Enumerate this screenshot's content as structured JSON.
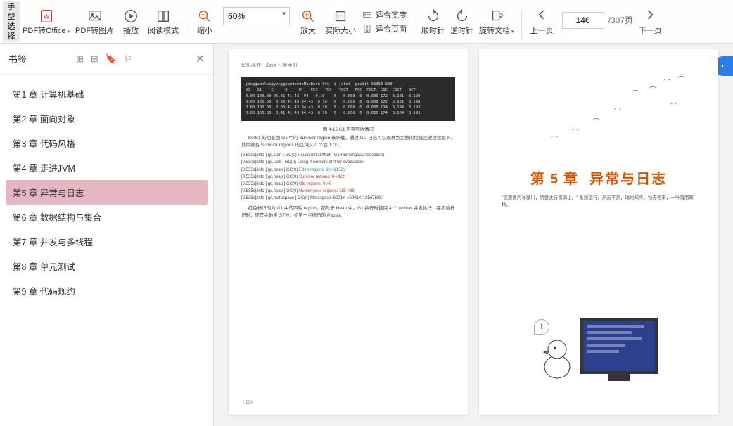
{
  "toolbar": {
    "handle_tab": "手型\n选择",
    "pdf_office": "PDF转Office",
    "pdf_image": "PDF转图片",
    "play": "播放",
    "read_mode": "阅读模式",
    "zoom_out": "缩小",
    "zoom_value": "60%",
    "zoom_in": "放大",
    "actual_size": "实际大小",
    "fit_width": "适合宽度",
    "fit_page": "适合页面",
    "rotate_cw": "顺时针",
    "rotate_ccw": "逆时针",
    "rotate_doc": "旋转文档",
    "prev_page": "上一页",
    "page_current": "146",
    "page_total": "/307页",
    "next_page": "下一页"
  },
  "sidebar": {
    "title": "书签",
    "items": [
      "第1 章 计算机基础",
      "第2 章 面向对象",
      "第3 章 代码风格",
      "第4 章 走进JVM",
      "第5 章 异常与日志",
      "第6 章 数据结构与集合",
      "第7 章 并发与多线程",
      "第8 章 单元测试",
      "第9 章 代码规约"
    ],
    "active_index": 4
  },
  "page_left": {
    "header": "码出高效：Java 开发手册",
    "code": "yongguanlao@yongguandeodeMacBook-Pro  $ jstat -gcutil 66353 300\nS0   S1    E     O     M    CCS   YGC   YGCT   FGC  FGCT  CGC  CGCT   GCT\n0.00 100.00 95.41 41.43  94   0.10    6   0.088  0  0.000 172  8.101  8.190\n0.00 100.00  0.36 41.43 94.43  0.10   6   0.088  0  0.000 172  8.101  8.190\n0.00 100.00  0.00 41.43 94.43  0.10   6   0.088  0  0.000 174  8.104  8.193\n0.00 100.00  0.41 41.43 94.43  0.10   6   0.088  0  0.000 174  8.104  8.193",
    "fig_caption": "图 4-15  G1 内存回收情况",
    "para1": "S0/S1 的功能由 G1 中的 Survivor region 来承载。通过 GC 日志可以观察到完整的垃圾回收过程如下，其中就有 Survivor regions 的区域从 0 个到 1 个。",
    "log_lines": [
      {
        "t": "[0.530s][info  ][gc,start   ] GC(0) Pause Initial Mark (G1 Humongous Allocation)",
        "r": ""
      },
      {
        "t": "[0.530s][info  ][gc,task    ] GC(0) Using 4 workers of 4 for evacuation",
        "r": ""
      },
      {
        "t": "[0.535s][info  ][gc,heap    ] GC(0) ",
        "r": "Eden regions: 2->0(152)",
        "c": "blue"
      },
      {
        "t": "[0.535s][info  ][gc,heap    ] GC(0) ",
        "r": "Survivor regions: 0->1(2)",
        "c": "red"
      },
      {
        "t": "[0.535s][info  ][gc,heap    ] GC(0) ",
        "r": "Old regions: 0->0",
        "c": "red"
      },
      {
        "t": "[0.535s][info  ][gc,heap    ] GC(0) ",
        "r": "Humongous regions: 115->39",
        "c": "red"
      },
      {
        "t": "[0.535s][info  ][gc,metaspace ] GC(0) Metaspace: 6001K->6001K(1056768K)",
        "r": ""
      }
    ],
    "para2": "红色标识的为 G1 中的四种 region，都处于 Heap 中。G1 执行时使用 4 个 worker 并发执行，在初始标记时，还是会触发 STW，如第一步所示的 Pause。",
    "page_num": "134"
  },
  "page_right": {
    "chapter_prefix": "第",
    "chapter_num": "5",
    "chapter_suffix": "章",
    "chapter_title": "异常与日志",
    "quote": "\"欲渡黄河冰塞川，将登太行雪满山。\" 系统运行，风云不测，瑞始知终，秋去冬来，一叶落而知秋。"
  }
}
